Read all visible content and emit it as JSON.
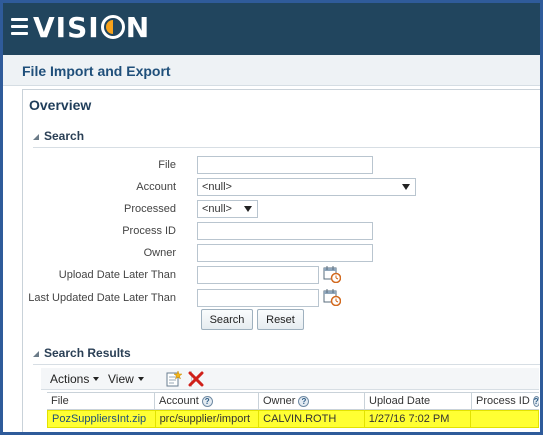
{
  "brand": {
    "name_prefix": "V",
    "name_mid": "ISI",
    "name_suffix": "N",
    "accent_color": "#f7a21b",
    "bar_color": "#21455e"
  },
  "page": {
    "title": "File Import and Export"
  },
  "overview": {
    "title": "Overview"
  },
  "search": {
    "section_title": "Search",
    "fields": {
      "file_label": "File",
      "account_label": "Account",
      "account_value": "<null>",
      "processed_label": "Processed",
      "processed_value": "<null>",
      "process_id_label": "Process ID",
      "owner_label": "Owner",
      "upload_date_label": "Upload Date Later Than",
      "last_updated_label": "Last Updated Date Later Than"
    },
    "search_button": "Search",
    "reset_button": "Reset"
  },
  "results": {
    "section_title": "Search Results",
    "toolbar": {
      "actions_label": "Actions",
      "view_label": "View"
    },
    "columns": [
      "File",
      "Account",
      "Owner",
      "Upload Date",
      "Process ID"
    ],
    "rows": [
      {
        "file": "PozSuppliersInt.zip",
        "account": "prc/supplier/import",
        "owner": "CALVIN.ROTH",
        "upload_date": "1/27/16 7:02 PM",
        "process_id": ""
      }
    ],
    "selected_row_color": "#ffff33"
  }
}
